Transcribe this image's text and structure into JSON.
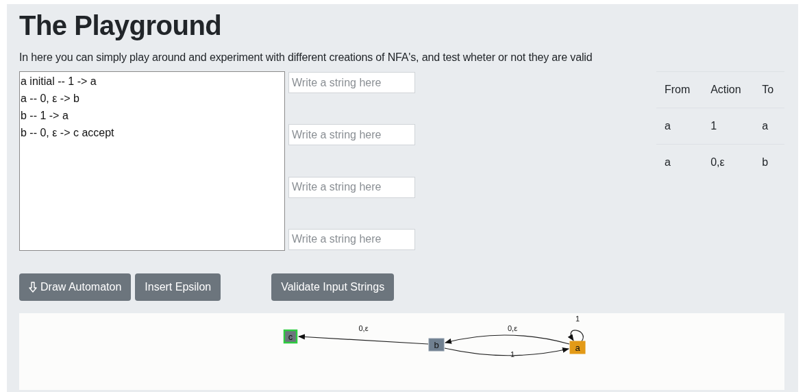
{
  "title": "The Playground",
  "description": "In here you can simply play around and experiment with different creations of NFA's, and test wheter or not they are valid",
  "editor": {
    "lines": [
      "a initial -- 1 -> a",
      "a -- 0, ε -> b",
      "b -- 1 -> a",
      "b -- 0, ε -> c accept"
    ]
  },
  "string_inputs": [
    {
      "placeholder": "Write a string here"
    },
    {
      "placeholder": "Write a string here"
    },
    {
      "placeholder": "Write a string here"
    },
    {
      "placeholder": "Write a string here"
    }
  ],
  "buttons": [
    {
      "label": "Draw Automaton",
      "kind": "draw"
    },
    {
      "label": "Insert Epsilon",
      "kind": "plain"
    },
    {
      "label": "Validate Input Strings",
      "kind": "validate"
    }
  ],
  "transitions": {
    "columns": [
      "From",
      "Action",
      "To"
    ],
    "rows": [
      [
        "a",
        "1",
        "a"
      ],
      [
        "a",
        "0,ε",
        "b"
      ]
    ]
  },
  "graph": {
    "nodes": [
      {
        "label": "c",
        "kind": "accept"
      },
      {
        "label": "b",
        "kind": "normal"
      },
      {
        "label": "a",
        "kind": "current"
      }
    ],
    "edges": [
      {
        "label": "0,ε",
        "kind": "straight"
      },
      {
        "label": "0,ε",
        "kind": "arc-up"
      },
      {
        "label": "1",
        "kind": "arc-down"
      },
      {
        "label": "1",
        "kind": "loop"
      }
    ]
  }
}
